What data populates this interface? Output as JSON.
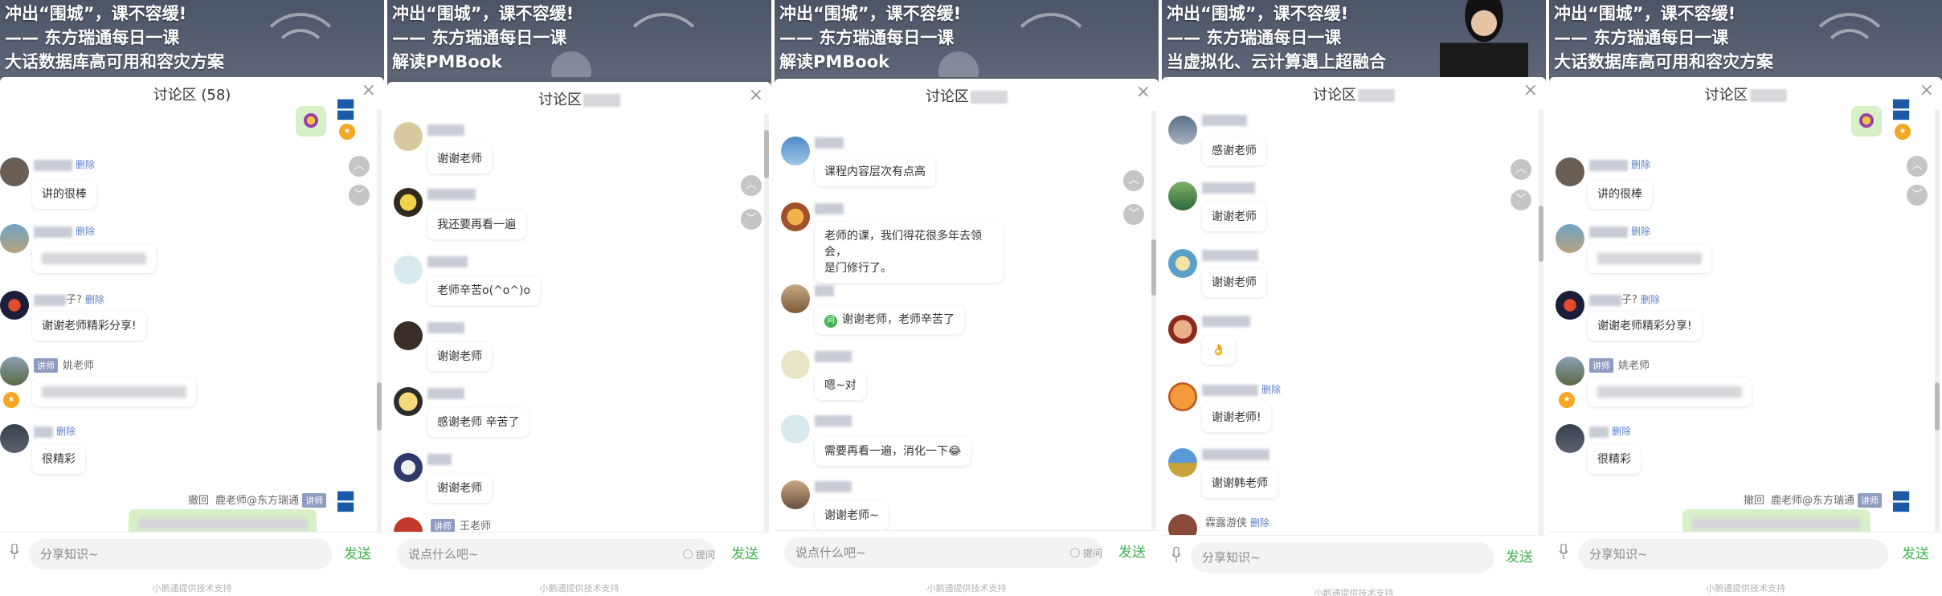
{
  "banner": {
    "line1": "冲出“围城”，课不容缓!",
    "line2": "—— 东方瑞通每日一课",
    "line3a": "大话数据库高可用和容灾方案",
    "line3b": "解读PMBook",
    "line3c": "当虚拟化、云计算遇上超融合"
  },
  "common": {
    "delete": "删除",
    "send": "发送",
    "footer": "小鹅通提供技术支持",
    "input_share": "分享知识~",
    "input_say": "说点什么吧~",
    "ask": "提问",
    "teacher_tag": "讲师",
    "recall": "撤回",
    "close": "×",
    "up": "︿",
    "down": "﹀"
  },
  "panel1": {
    "title": "讨论区 (58)",
    "msgs": [
      "讲的很棒",
      "",
      "谢谢老师精彩分享!",
      "",
      "很精彩"
    ],
    "names": {
      "m3": "子?",
      "m4": "姚老师",
      "last": "鹿老师@东方瑞通"
    }
  },
  "panel2": {
    "title": "讨论区",
    "msgs": [
      "谢谢老师",
      "我还要再看一遍",
      "老师辛苦o(^o^)o",
      "谢谢老师",
      "感谢老师 辛苦了",
      "谢谢老师"
    ],
    "last_name": "王老师"
  },
  "panel3": {
    "title": "讨论区",
    "msgs": [
      "课程内容层次有点高",
      "老师的课，我们得花很多年去领会，",
      "是门修行了。",
      "谢谢老师，老师辛苦了",
      "嗯~对",
      "需要再看一遍，消化一下😂",
      "谢谢老师~"
    ],
    "q_badge": "问"
  },
  "panel4": {
    "title": "讨论区",
    "msgs": [
      "感谢老师",
      "谢谢老师",
      "谢谢老师",
      "👌",
      "谢谢老师!",
      "谢谢韩老师"
    ],
    "last_name": "霖露游侠"
  },
  "panel5": {
    "title": "讨论区",
    "msgs": [
      "讲的很棒",
      "",
      "谢谢老师精彩分享!",
      "",
      "很精彩"
    ],
    "names": {
      "m3": "子?",
      "m4": "姚老师",
      "last": "鹿老师@东方瑞通"
    }
  },
  "colors": {
    "accent_green": "#3fb34f",
    "bubble_green": "#d7f0c8",
    "link_blue": "#5b7fc7"
  }
}
